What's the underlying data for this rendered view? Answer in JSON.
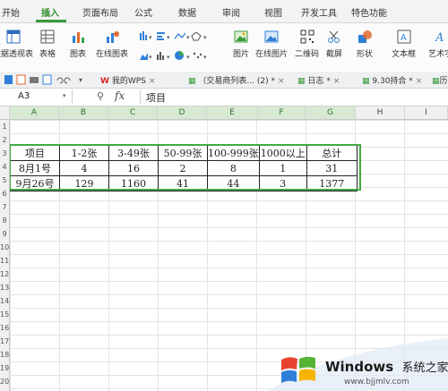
{
  "menu_tabs": [
    "开始",
    "插入",
    "页面布局",
    "公式",
    "数据",
    "审阅",
    "视图",
    "开发工具",
    "特色功能"
  ],
  "active_tab": "插入",
  "ribbon": {
    "pivot_label": "数据透视表",
    "table_label": "表格",
    "chart_label": "图表",
    "online_chart_label": "在线图表",
    "picture_label": "图片",
    "online_picture_label": "在线图片",
    "qrcode_label": "二维码",
    "screenshot_label": "截屏",
    "shapes_label": "形状",
    "textbox_label": "文本框",
    "wordart_label": "艺术字"
  },
  "doc_tabs": [
    {
      "label": "我的WPS",
      "closable": true
    },
    {
      "label": "（交易商列表... (2) *",
      "closable": true
    },
    {
      "label": "日志 *",
      "closable": true
    },
    {
      "label": "9.30持合 *",
      "closable": true
    },
    {
      "label": "历",
      "closable": false
    }
  ],
  "formula_bar": {
    "cell_ref": "A3",
    "fx_label": "fx",
    "content": "项目"
  },
  "columns": [
    "A",
    "B",
    "C",
    "D",
    "E",
    "F",
    "G",
    "H",
    "I"
  ],
  "selected_columns": [
    "A",
    "B",
    "C",
    "D",
    "E",
    "F",
    "G"
  ],
  "row_numbers": [
    "1",
    "2",
    "3",
    "4",
    "5",
    "6",
    "7",
    "8",
    "9",
    "10",
    "11",
    "12",
    "13",
    "14",
    "15",
    "16",
    "17",
    "18",
    "19",
    "20"
  ],
  "table": {
    "header": [
      "项目",
      "1-2张",
      "3-49张",
      "50-99张",
      "100-999张",
      "1000以上",
      "总计"
    ],
    "rows": [
      [
        "8月1号",
        "4",
        "16",
        "2",
        "8",
        "1",
        "31"
      ],
      [
        "9月26号",
        "129",
        "1160",
        "41",
        "44",
        "3",
        "1377"
      ]
    ]
  },
  "watermark": {
    "brand": "Windows",
    "suffix": "系统之家",
    "url": "www.bjjmlv.com"
  },
  "colors": {
    "accent_green": "#3a9b3a",
    "windows_blue": "#0a6fd1"
  }
}
